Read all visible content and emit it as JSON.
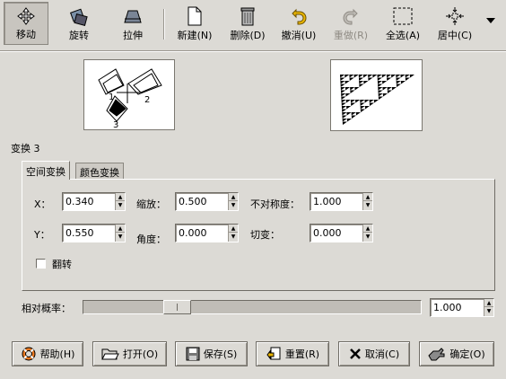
{
  "toolbar": {
    "items": [
      {
        "label": "移动",
        "icon": "move-icon"
      },
      {
        "label": "旋转",
        "icon": "rotate-icon"
      },
      {
        "label": "拉伸",
        "icon": "stretch-icon"
      },
      {
        "label": "新建(N)",
        "icon": "new-document-icon"
      },
      {
        "label": "删除(D)",
        "icon": "trash-icon"
      },
      {
        "label": "撤消(U)",
        "icon": "undo-icon"
      },
      {
        "label": "重做(R)",
        "icon": "redo-icon"
      },
      {
        "label": "全选(A)",
        "icon": "select-all-icon"
      },
      {
        "label": "居中(C)",
        "icon": "center-icon"
      }
    ],
    "overflow_icon": "dropdown-arrow-icon"
  },
  "preview": {
    "labels": [
      "1",
      "2",
      "3"
    ]
  },
  "transform": {
    "title": "变换 3",
    "tabs": [
      "空间变换",
      "颜色变换"
    ],
    "x_label": "X：",
    "x_value": "0.340",
    "y_label": "Y：",
    "y_value": "0.550",
    "scale_label": "缩放：",
    "scale_value": "0.500",
    "angle_label": "角度：",
    "angle_value": "0.000",
    "asym_label": "不对称度：",
    "asym_value": "1.000",
    "shear_label": "切变：",
    "shear_value": "0.000",
    "flip_label": "翻转"
  },
  "probability": {
    "label": "相对概率：",
    "value": "1.000",
    "slider_fraction": 0.26
  },
  "buttons": {
    "help": "帮助(H)",
    "open": "打开(O)",
    "save": "保存(S)",
    "reset": "重置(R)",
    "cancel": "取消(C)",
    "ok": "确定(O)"
  },
  "colors": {
    "background": "#dcdad5",
    "shadow": "#6f6c65"
  }
}
